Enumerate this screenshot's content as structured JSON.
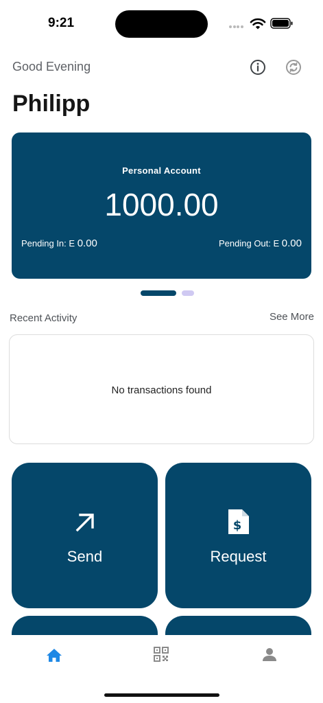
{
  "status_bar": {
    "time": "9:21"
  },
  "header": {
    "greeting": "Good Evening",
    "user_name": "Philipp",
    "info_icon": "info-icon",
    "sync_icon": "sync-icon"
  },
  "account_card": {
    "account_type": "Personal Account",
    "balance": "1000.00",
    "pending_in_label": "Pending In: E",
    "pending_in_value": "0.00",
    "pending_out_label": "Pending Out: E",
    "pending_out_value": "0.00",
    "page_count": 2,
    "active_page": 1
  },
  "recent_activity": {
    "title": "Recent Activity",
    "see_more": "See More",
    "empty_message": "No transactions found"
  },
  "actions": [
    {
      "label": "Send",
      "icon": "arrow-up-right-icon"
    },
    {
      "label": "Request",
      "icon": "invoice-dollar-icon"
    }
  ],
  "bottom_nav": {
    "items": [
      {
        "icon": "home-icon",
        "active": true
      },
      {
        "icon": "qr-code-icon",
        "active": false
      },
      {
        "icon": "profile-icon",
        "active": false
      }
    ]
  },
  "colors": {
    "primary": "#05476a",
    "nav_active": "#1e88e5",
    "nav_inactive": "#8a8a8a",
    "dot_inactive": "#cfc9f2"
  }
}
